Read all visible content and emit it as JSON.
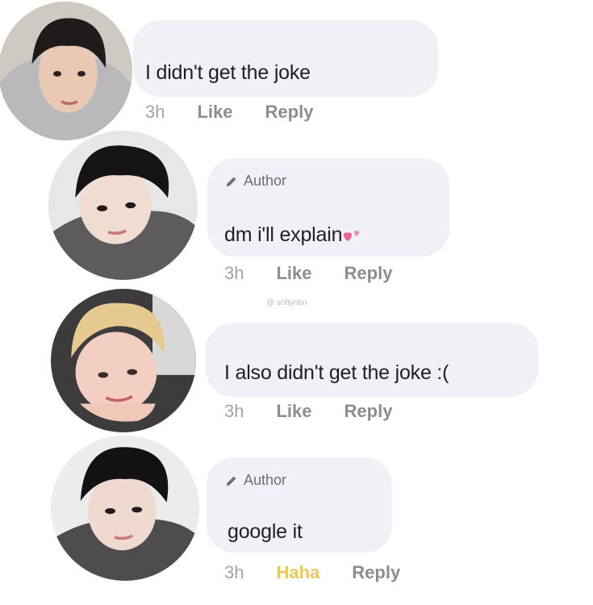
{
  "comments": [
    {
      "text": "I didn't get the joke",
      "time": "3h",
      "like": "Like",
      "reply": "Reply"
    },
    {
      "author_badge": "Author",
      "text": "dm i'll explain",
      "time": "3h",
      "like": "Like",
      "reply": "Reply"
    },
    {
      "text": "I also didn't get the joke :(",
      "time": "3h",
      "like": "Like",
      "reply": "Reply"
    },
    {
      "author_badge": "Author",
      "text": "google it",
      "time": "3h",
      "reaction": "Haha",
      "reply": "Reply"
    }
  ],
  "watermark": "@ softynbn",
  "colors": {
    "bubble": "#f0f1f6",
    "haha": "#e8c95a",
    "heart": "#f06292"
  },
  "icons": [
    "pencil-icon",
    "two-hearts-emoji"
  ]
}
